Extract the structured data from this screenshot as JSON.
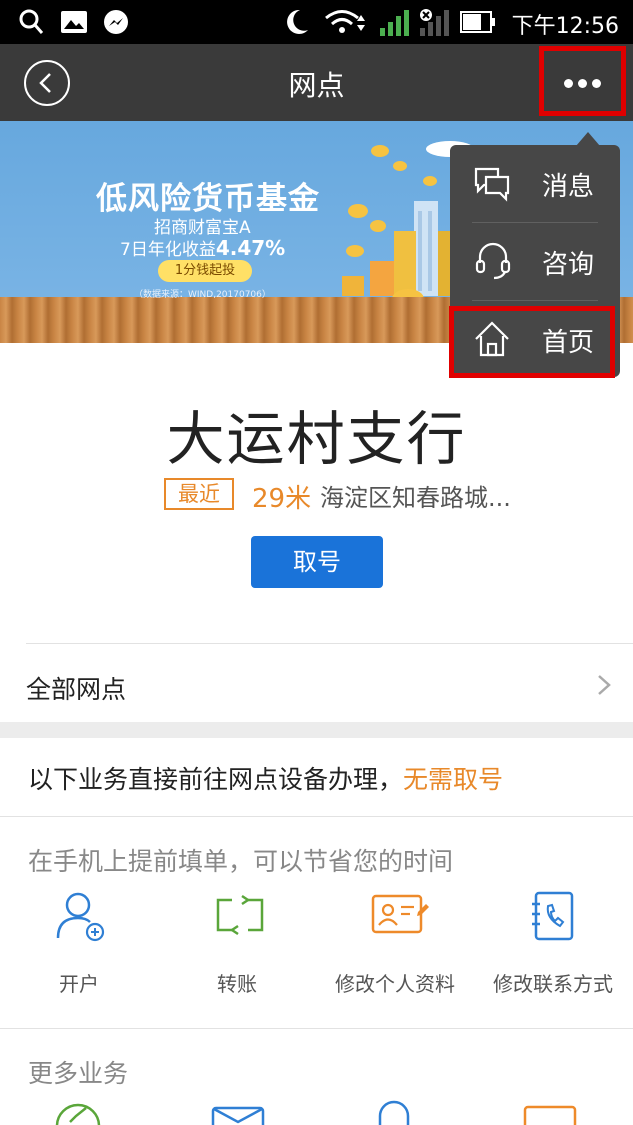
{
  "status_bar": {
    "time": "下午12:56"
  },
  "nav": {
    "title": "网点"
  },
  "banner": {
    "title": "低风险货币基金",
    "subtitle": "招商财富宝A",
    "rate_prefix": "7日年化收益",
    "rate_value": "4.47%",
    "pill": "1分钱起投",
    "source": "（数据来源：WIND,20170706）"
  },
  "menu": {
    "items": [
      {
        "label": "消息",
        "icon": "message-icon"
      },
      {
        "label": "咨询",
        "icon": "headset-icon"
      },
      {
        "label": "首页",
        "icon": "home-icon"
      }
    ]
  },
  "branch": {
    "name": "大运村支行",
    "badge": "最近",
    "distance": "29米",
    "address": "海淀区知春路城...",
    "take_number": "取号"
  },
  "all_branches": {
    "label": "全部网点"
  },
  "notice": {
    "text": "以下业务直接前往网点设备办理，",
    "highlight": "无需取号"
  },
  "prefill": {
    "title": "在手机上提前填单，可以节省您的时间",
    "services": [
      {
        "label": "开户",
        "icon": "add-user-icon"
      },
      {
        "label": "转账",
        "icon": "transfer-icon"
      },
      {
        "label": "修改个人资料",
        "icon": "edit-profile-icon"
      },
      {
        "label": "修改联系方式",
        "icon": "edit-contact-icon"
      }
    ]
  },
  "more": {
    "title": "更多业务"
  },
  "colors": {
    "accent": "#1a73d9",
    "highlight": "#e8892a",
    "nav_bg": "#3a3a3a",
    "menu_bg": "#474747",
    "annotation": "#e00000"
  }
}
